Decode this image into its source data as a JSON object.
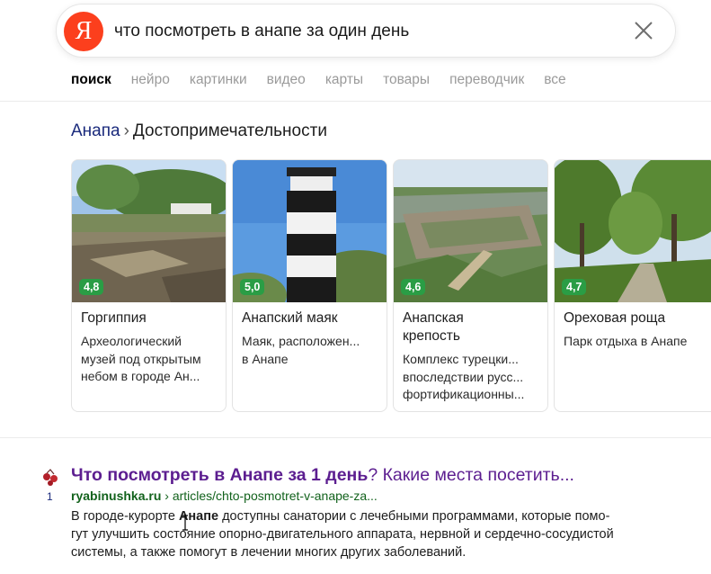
{
  "search": {
    "logo_letter": "Я",
    "query": "что посмотреть в анапе за один день"
  },
  "tabs": [
    {
      "label": "поиск",
      "active": true
    },
    {
      "label": "нейро",
      "active": false
    },
    {
      "label": "картинки",
      "active": false
    },
    {
      "label": "видео",
      "active": false
    },
    {
      "label": "карты",
      "active": false
    },
    {
      "label": "товары",
      "active": false
    },
    {
      "label": "переводчик",
      "active": false
    },
    {
      "label": "все",
      "active": false
    }
  ],
  "breadcrumb": {
    "city": "Анапа",
    "separator": "›",
    "section": "Достопримечательности"
  },
  "attractions": [
    {
      "title": "Горгиппия",
      "rating": "4,8",
      "desc_lines": [
        "Археологический",
        "музей под открытым",
        "небом в городе Ан..."
      ]
    },
    {
      "title": "Анапский маяк",
      "rating": "5,0",
      "desc_lines": [
        "Маяк, расположен...",
        "в Анапе"
      ]
    },
    {
      "title_lines": [
        "Анапская",
        "крепость"
      ],
      "rating": "4,6",
      "desc_lines": [
        "Комплекс турецки...",
        "впоследствии русс...",
        "фортификационны..."
      ]
    },
    {
      "title": "Ореховая роща",
      "rating": "4,7",
      "desc_lines": [
        "Парк отдыха в Анапе"
      ]
    }
  ],
  "result": {
    "rank": "1",
    "title_bold": "Что посмотреть в Анапе за 1 день",
    "title_rest": "? Какие места посетить...",
    "domain": "ryabinushka.ru",
    "path": "› articles/chto-posmotret-v-anape-za...",
    "snippet_lines": [
      {
        "pre": "В городе-курорте ",
        "bold": "Анапе",
        "post": " доступны санатории с лечебными программами, которые помо-"
      },
      {
        "pre": "гут улучшить состояние опорно-двигательного аппарата, нервной и сердечно-сосудистой",
        "bold": "",
        "post": ""
      },
      {
        "pre": "системы, а также помогут в лечении многих других заболеваний.",
        "bold": "",
        "post": ""
      }
    ]
  },
  "colors": {
    "brand": "#fc3f1d",
    "rating_badge": "#2a9d45",
    "visited_link": "#5c1e90",
    "url_green": "#12621c"
  }
}
